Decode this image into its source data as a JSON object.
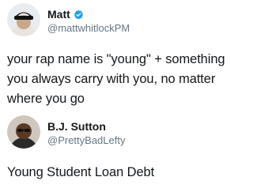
{
  "tweets": [
    {
      "display_name": "Matt",
      "handle": "@mattwhitlockPM",
      "verified": true,
      "text_lines": [
        "your rap name is \"young\" + something",
        "you always carry with you, no matter",
        "where you go"
      ]
    },
    {
      "display_name": "B.J. Sutton",
      "handle": "@PrettyBadLefty",
      "verified": false,
      "text_lines": [
        "Young Student Loan Debt"
      ]
    }
  ],
  "colors": {
    "text_primary": "#14171a",
    "text_secondary": "#657786",
    "verified_blue": "#1da1f2"
  },
  "icons": {
    "verified": "verified-badge-icon"
  }
}
